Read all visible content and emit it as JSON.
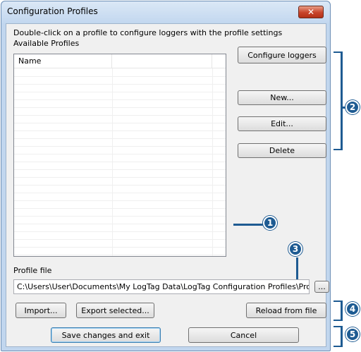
{
  "window": {
    "title": "Configuration Profiles",
    "close_glyph": "✕"
  },
  "instructions": "Double-click on a profile to configure loggers with the profile settings",
  "profiles": {
    "label": "Available Profiles",
    "columns": [
      "Name",
      "",
      ""
    ],
    "rows": []
  },
  "buttons": {
    "configure_loggers": "Configure loggers",
    "new": "New...",
    "edit": "Edit...",
    "delete": "Delete",
    "import": "Import...",
    "export_selected": "Export selected...",
    "reload_from_file": "Reload from file",
    "save_changes_and_exit": "Save changes and exit",
    "cancel": "Cancel",
    "browse": "..."
  },
  "profile_file": {
    "label": "Profile file",
    "value": "C:\\Users\\User\\Documents\\My LogTag Data\\LogTag Configuration Profiles\\Profiles.ltp"
  },
  "callouts": {
    "one": "1",
    "two": "2",
    "three": "3",
    "four": "4",
    "five": "5"
  },
  "colors": {
    "callout": "#1e5b92",
    "close_button": "#c8442a",
    "titlebar": "#c2d7ef"
  }
}
